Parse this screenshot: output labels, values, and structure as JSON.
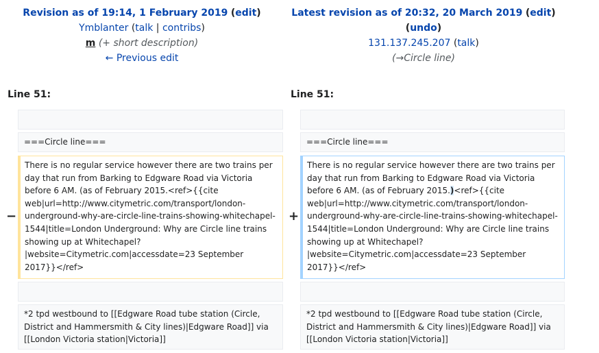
{
  "left": {
    "title_prefix": "Revision as of 19:14, 1 February 2019",
    "edit_link": "edit",
    "user": "Ymblanter",
    "talk": "talk",
    "contribs": "contribs",
    "minor_marker": "m",
    "summary": "(+ short description)",
    "prev_edit": "← Previous edit",
    "line_label": "Line 51:"
  },
  "right": {
    "title_prefix": "Latest revision as of 20:32, 20 March 2019",
    "edit_link": "edit",
    "undo_link": "undo",
    "user": "131.137.245.207",
    "talk": "talk",
    "summary": "(→Circle line)",
    "line_label": "Line 51:"
  },
  "diff": {
    "context_heading": "===Circle line===",
    "del_marker": "−",
    "ins_marker": "+",
    "old_text": "There is no regular service however there are two trains per day that run from Barking to Edgware Road via Victoria before 6 AM. (as of February 2015.<ref>{{cite web|url=http://www.citymetric.com/transport/london-underground-why-are-circle-line-trains-showing-whitechapel-1544|title=London Underground: Why are Circle line trains showing up at Whitechapel?|website=Citymetric.com|accessdate=23 September 2017}}</ref>",
    "new_text_before": "There is no regular service however there are two trains per day that run from Barking to Edgware Road via Victoria before 6 AM. (as of February 2015.",
    "new_text_added": ")",
    "new_text_after": "<ref>{{cite web|url=http://www.citymetric.com/transport/london-underground-why-are-circle-line-trains-showing-whitechapel-1544|title=London Underground: Why are Circle line trains showing up at Whitechapel?|website=Citymetric.com|accessdate=23 September 2017}}</ref>",
    "context_trailing": "*2 tpd westbound to [[Edgware Road tube station (Circle, District and Hammersmith & City lines)|Edgware Road]] via [[London Victoria station|Victoria]]"
  },
  "colors": {
    "link": "#0645ad",
    "deleted_border": "#ffe49c",
    "added_border": "#a3d3ff",
    "context_bg": "#f8f9fa"
  }
}
